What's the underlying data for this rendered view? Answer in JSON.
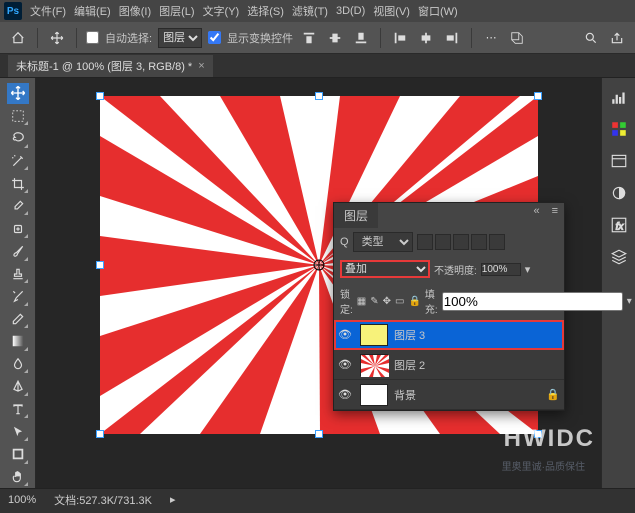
{
  "menu": {
    "items": [
      "文件(F)",
      "编辑(E)",
      "图像(I)",
      "图层(L)",
      "文字(Y)",
      "选择(S)",
      "滤镜(T)",
      "3D(D)",
      "视图(V)",
      "窗口(W)"
    ]
  },
  "options": {
    "auto_select_label": "自动选择:",
    "auto_select_checked": false,
    "target": "图层",
    "show_transform_label": "显示变换控件",
    "show_transform_checked": true
  },
  "tab": {
    "title": "未标题-1 @ 100% (图层 3, RGB/8) *",
    "close": "×"
  },
  "layers": {
    "panel_title": "图层",
    "search_prefix": "Q",
    "search_value": "类型",
    "blend_mode": "叠加",
    "opacity_label": "不透明度:",
    "opacity_value": "100%",
    "lock_label": "锁定:",
    "fill_label": "填充:",
    "fill_value": "100%",
    "items": [
      {
        "name": "图层 3",
        "thumb_color": "#f7f27a",
        "visible": true,
        "selected": true
      },
      {
        "name": "图层 2",
        "thumb_color": "sunburst",
        "visible": true,
        "selected": false
      },
      {
        "name": "背景",
        "thumb_color": "#ffffff",
        "visible": true,
        "selected": false,
        "locked": true
      }
    ]
  },
  "status": {
    "zoom": "100%",
    "doc_info": "文档:527.3K/731.3K"
  },
  "watermark": "HWIDC",
  "watermark2": "里奥里诚·品质保住"
}
